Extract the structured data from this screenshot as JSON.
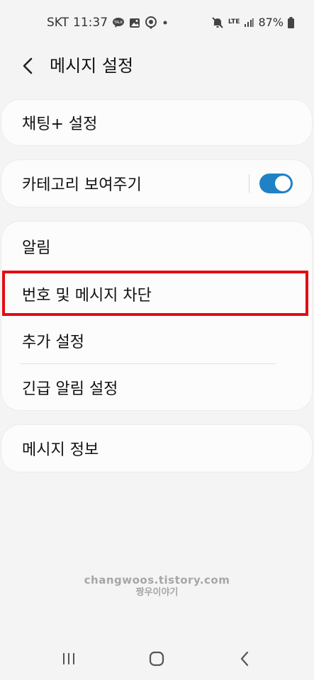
{
  "status_bar": {
    "carrier": "SKT",
    "time": "11:37",
    "network": "LTE",
    "battery": "87%",
    "icons": [
      "talk-bubble-icon",
      "image-icon",
      "location-pin-icon",
      "dot-icon",
      "mute-icon",
      "signal-icon",
      "battery-icon"
    ]
  },
  "header": {
    "title": "메시지 설정",
    "back_icon": "chevron-left-icon"
  },
  "settings": {
    "chat_plus": "채팅+ 설정",
    "show_categories": "카테고리 보여주기",
    "show_categories_on": true,
    "notifications": "알림",
    "block_numbers": "번호 및 메시지 차단",
    "more_settings": "추가 설정",
    "emergency_alerts": "긴급 알림 설정",
    "about": "메시지 정보"
  },
  "highlight": {
    "color": "#e50b12",
    "target": "번호 및 메시지 차단"
  },
  "watermark": {
    "line1": "changwoos.tistory.com",
    "line2": "짱우이야기"
  },
  "nav": {
    "recents_icon": "recent-apps-icon",
    "home_icon": "home-icon",
    "back_icon": "back-icon"
  },
  "colors": {
    "toggle_on": "#1f82c4",
    "background": "#f4f4f4",
    "card": "#fcfcfc"
  }
}
